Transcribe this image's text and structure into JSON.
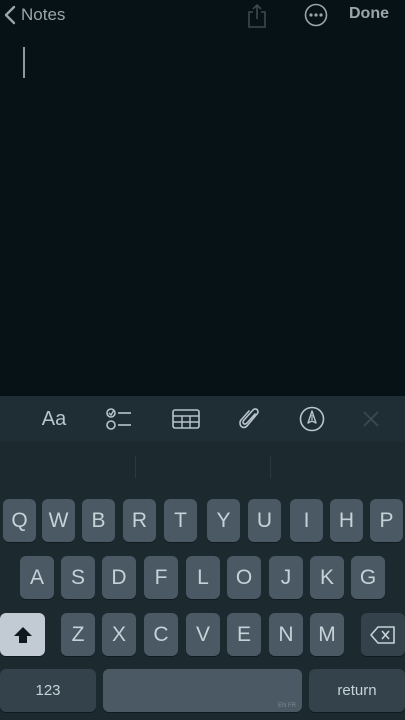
{
  "nav": {
    "back_label": "Notes",
    "done_label": "Done",
    "icons": [
      "chevron-left-icon",
      "share-icon",
      "more-icon"
    ]
  },
  "editor": {
    "text": ""
  },
  "toolbar": {
    "format_label": "Aa",
    "icons": [
      "checklist-icon",
      "table-icon",
      "paperclip-icon",
      "markup-pen-icon",
      "close-icon"
    ]
  },
  "keyboard": {
    "row1": [
      "Q",
      "W",
      "B",
      "R",
      "T",
      "Y",
      "U",
      "I",
      "H",
      "P"
    ],
    "row2": [
      "A",
      "S",
      "D",
      "F",
      "L",
      "O",
      "J",
      "K",
      "G"
    ],
    "row3": [
      "Z",
      "X",
      "C",
      "V",
      "E",
      "N",
      "M"
    ],
    "numbers_label": "123",
    "space_lang_label": "EN FR",
    "return_label": "return",
    "icons": [
      "shift-icon",
      "backspace-icon"
    ]
  },
  "colors": {
    "background": "#071216",
    "toolbar": "#1f2e35",
    "keyboard": "#1c2a30",
    "key": "#4a5963",
    "shift_active": "#c2cbd3"
  }
}
